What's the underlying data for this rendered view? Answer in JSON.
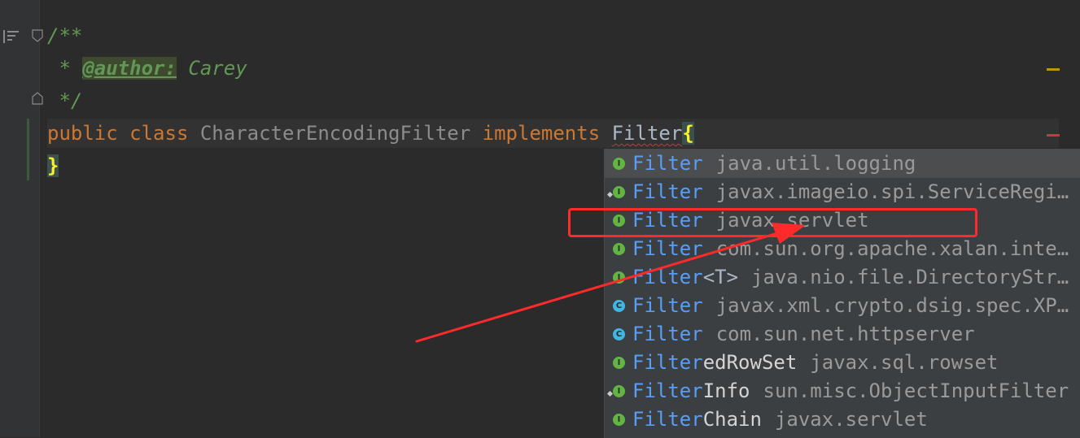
{
  "editor": {
    "lines": {
      "l1": {
        "comment_open": "/**"
      },
      "l2": {
        "prefix": " * ",
        "tag": "@author:",
        "value": " Carey"
      },
      "l3": {
        "comment_close": " */"
      },
      "l4": {
        "kw_public": "public",
        "kw_class": "class",
        "class_name": "CharacterEncodingFilter",
        "kw_implements": "implements",
        "typed": "Filter",
        "brace": "{"
      },
      "l5": {
        "brace": "}"
      }
    }
  },
  "completion": {
    "items": [
      {
        "icon": "interface-icon",
        "match": "Filter",
        "rest": "",
        "param": "",
        "pkg": "java.util.logging",
        "selected": true
      },
      {
        "icon": "interface-icon",
        "match": "Filter",
        "rest": "",
        "param": "",
        "pkg": "javax.imageio.spi.ServiceRegi…"
      },
      {
        "icon": "interface-icon",
        "match": "Filter",
        "rest": "",
        "param": "",
        "pkg": "javax.servlet"
      },
      {
        "icon": "interface-icon",
        "match": "Filter",
        "rest": "",
        "param": "",
        "pkg": "com.sun.org.apache.xalan.inte…"
      },
      {
        "icon": "interface-icon",
        "match": "Filter",
        "rest": "",
        "param": "<T>",
        "pkg": "java.nio.file.DirectoryStr…"
      },
      {
        "icon": "class-icon",
        "match": "Filter",
        "rest": "",
        "param": "",
        "pkg": "javax.xml.crypto.dsig.spec.XP…"
      },
      {
        "icon": "class-icon",
        "match": "Filter",
        "rest": "",
        "param": "",
        "pkg": "com.sun.net.httpserver"
      },
      {
        "icon": "interface-icon",
        "match": "Filter",
        "rest": "edRowSet",
        "param": "",
        "pkg": "javax.sql.rowset"
      },
      {
        "icon": "interface-icon",
        "match": "Filter",
        "rest": "Info",
        "param": "",
        "pkg": "sun.misc.ObjectInputFilter"
      },
      {
        "icon": "interface-icon",
        "match": "Filter",
        "rest": "Chain",
        "param": "",
        "pkg": "javax.servlet"
      }
    ]
  },
  "colors": {
    "annotation_box": "#ff2b2b",
    "match_highlight": "#589df6"
  }
}
